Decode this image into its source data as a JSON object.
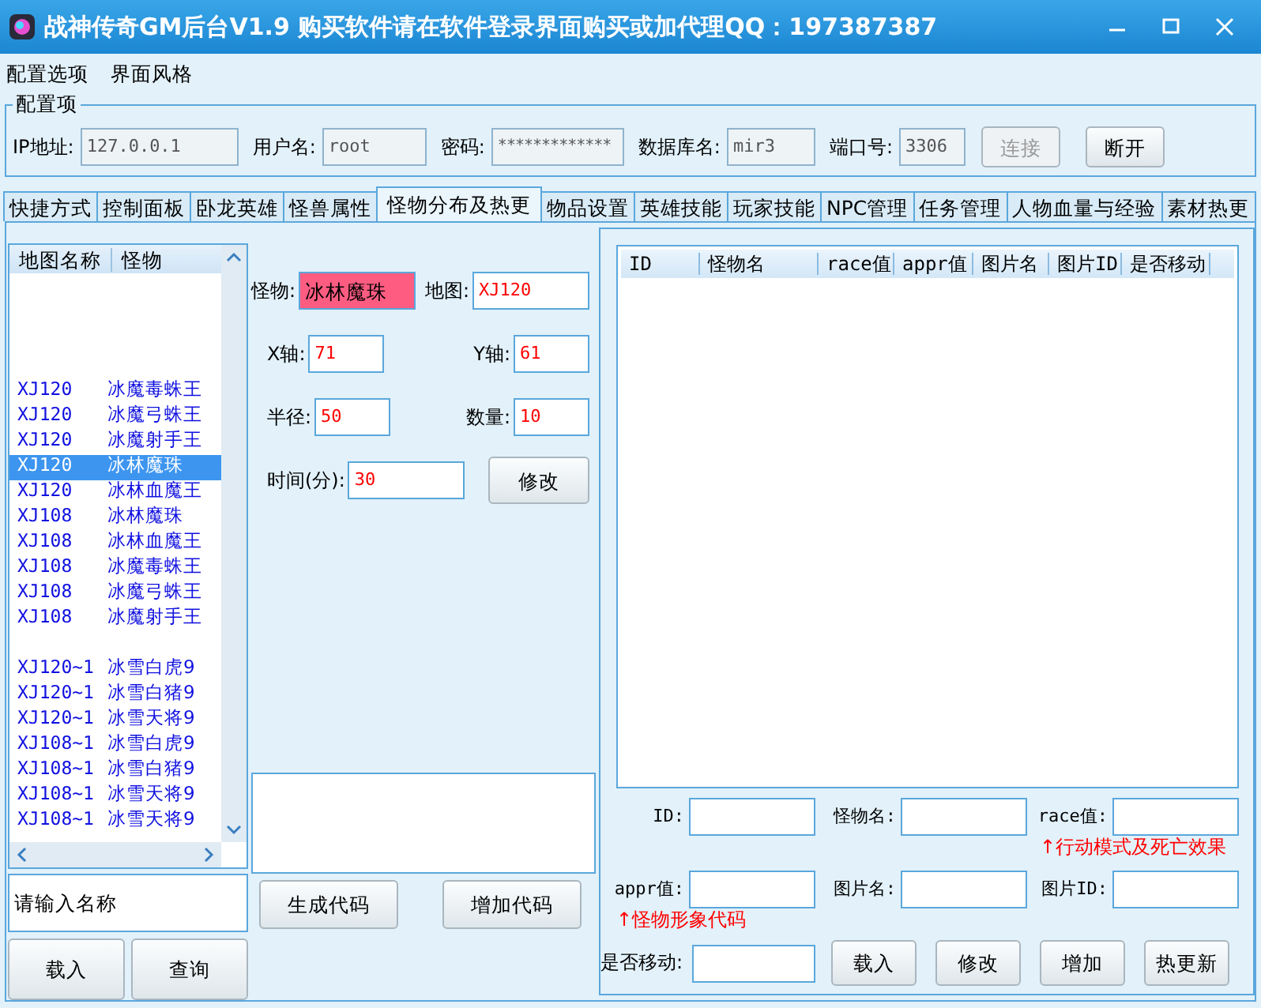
{
  "window": {
    "title": "战神传奇GM后台V1.9   购买软件请在软件登录界面购买或加代理QQ：197387387"
  },
  "menu": [
    {
      "label": "配置选项"
    },
    {
      "label": "界面风格"
    }
  ],
  "config": {
    "legend": "配置项",
    "fields": [
      {
        "label": "IP地址:",
        "value": "127.0.0.1",
        "disabled": true
      },
      {
        "label": "用户名:",
        "value": "root",
        "disabled": true
      },
      {
        "label": "密码:",
        "value": "*************",
        "disabled": true
      },
      {
        "label": "数据库名:",
        "value": "mir3",
        "disabled": true
      },
      {
        "label": "端口号:",
        "value": "3306",
        "disabled": true
      }
    ],
    "buttons": [
      {
        "label": "连接",
        "disabled": true
      },
      {
        "label": "断开",
        "disabled": false
      }
    ]
  },
  "tabs": [
    {
      "label": "快捷方式",
      "selected": false
    },
    {
      "label": "控制面板",
      "selected": false
    },
    {
      "label": "卧龙英雄",
      "selected": false
    },
    {
      "label": "怪兽属性",
      "selected": false
    },
    {
      "label": "怪物分布及热更",
      "selected": true
    },
    {
      "label": "物品设置",
      "selected": false
    },
    {
      "label": "英雄技能",
      "selected": false
    },
    {
      "label": "玩家技能",
      "selected": false
    },
    {
      "label": "NPC管理",
      "selected": false
    },
    {
      "label": "任务管理",
      "selected": false
    },
    {
      "label": "人物血量与经验",
      "selected": false
    },
    {
      "label": "素材热更",
      "selected": false
    }
  ],
  "map_list": {
    "columns": [
      "地图名称",
      "怪物"
    ],
    "groups": [
      {
        "rows": [
          {
            "map": "XJ120",
            "monster": "冰魔毒蛛王",
            "selected": false
          },
          {
            "map": "XJ120",
            "monster": "冰魔弓蛛王",
            "selected": false
          },
          {
            "map": "XJ120",
            "monster": "冰魔射手王",
            "selected": false
          },
          {
            "map": "XJ120",
            "monster": "冰林魔珠",
            "selected": true
          },
          {
            "map": "XJ120",
            "monster": "冰林血魔王",
            "selected": false
          },
          {
            "map": "XJ108",
            "monster": "冰林魔珠",
            "selected": false
          },
          {
            "map": "XJ108",
            "monster": "冰林血魔王",
            "selected": false
          },
          {
            "map": "XJ108",
            "monster": "冰魔毒蛛王",
            "selected": false
          },
          {
            "map": "XJ108",
            "monster": "冰魔弓蛛王",
            "selected": false
          },
          {
            "map": "XJ108",
            "monster": "冰魔射手王",
            "selected": false
          }
        ]
      },
      {
        "rows": [
          {
            "map": "XJ120~1",
            "monster": "冰雪白虎9",
            "selected": false
          },
          {
            "map": "XJ120~1",
            "monster": "冰雪白猪9",
            "selected": false
          },
          {
            "map": "XJ120~1",
            "monster": "冰雪天将9",
            "selected": false
          },
          {
            "map": "XJ108~1",
            "monster": "冰雪白虎9",
            "selected": false
          },
          {
            "map": "XJ108~1",
            "monster": "冰雪白猪9",
            "selected": false
          },
          {
            "map": "XJ108~1",
            "monster": "冰雪天将9",
            "selected": false
          },
          {
            "map": "XJ108~1",
            "monster": "冰雪天将9",
            "selected": false
          }
        ]
      }
    ]
  },
  "search": {
    "value": "请输入名称"
  },
  "list_buttons": [
    "载入",
    "查询"
  ],
  "editor": {
    "rows": [
      {
        "fields": [
          {
            "label": "怪物:",
            "value": "冰林魔珠",
            "highlighted": true
          },
          {
            "label": "地图:",
            "value": "XJ120",
            "highlighted": false
          }
        ]
      },
      {
        "fields": [
          {
            "label": "X轴:",
            "value": "71",
            "highlighted": false
          },
          {
            "label": "Y轴:",
            "value": "61",
            "highlighted": false
          }
        ]
      },
      {
        "fields": [
          {
            "label": "半径:",
            "value": "50",
            "highlighted": false
          },
          {
            "label": "数量:",
            "value": "10",
            "highlighted": false
          }
        ]
      },
      {
        "fields": [
          {
            "label": "时间(分):",
            "value": "30",
            "highlighted": false
          }
        ],
        "button": "修改"
      }
    ],
    "buttons": [
      "生成代码",
      "增加代码"
    ]
  },
  "monster_table": {
    "columns": [
      "ID",
      "怪物名",
      "race值",
      "appr值",
      "图片名",
      "图片ID",
      "是否移动"
    ]
  },
  "monster_form": {
    "rows": [
      {
        "fields": [
          {
            "label": "ID:"
          },
          {
            "label": "怪物名:"
          },
          {
            "label": "race值:",
            "hint": "↑行动模式及死亡效果"
          }
        ]
      },
      {
        "fields": [
          {
            "label": "appr值:",
            "hint": "↑怪物形象代码"
          },
          {
            "label": "图片名:"
          },
          {
            "label": "图片ID:"
          }
        ]
      }
    ],
    "move_field": {
      "label": "是否移动:"
    },
    "buttons": [
      "载入",
      "修改",
      "增加",
      "热更新"
    ]
  }
}
